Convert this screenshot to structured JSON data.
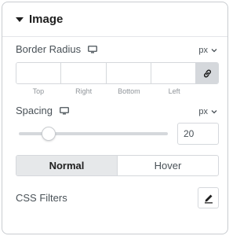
{
  "section": {
    "title": "Image",
    "caret_icon": "caret-down-icon"
  },
  "border_radius": {
    "label": "Border Radius",
    "device_icon": "desktop-icon",
    "unit": "px",
    "fields": [
      {
        "label": "Top",
        "value": ""
      },
      {
        "label": "Right",
        "value": ""
      },
      {
        "label": "Bottom",
        "value": ""
      },
      {
        "label": "Left",
        "value": ""
      }
    ],
    "link_icon": "link-icon",
    "linked": true
  },
  "spacing": {
    "label": "Spacing",
    "device_icon": "desktop-icon",
    "unit": "px",
    "value": "20",
    "slider_fraction": 0.2
  },
  "state_tabs": [
    {
      "label": "Normal",
      "active": true
    },
    {
      "label": "Hover",
      "active": false
    }
  ],
  "css_filters": {
    "label": "CSS Filters",
    "edit_icon": "pencil-icon"
  },
  "colors": {
    "text": "#495157",
    "active_tab": "#e6e8ea",
    "border": "#d5d8dc",
    "link_bg": "#d5d8dc"
  }
}
